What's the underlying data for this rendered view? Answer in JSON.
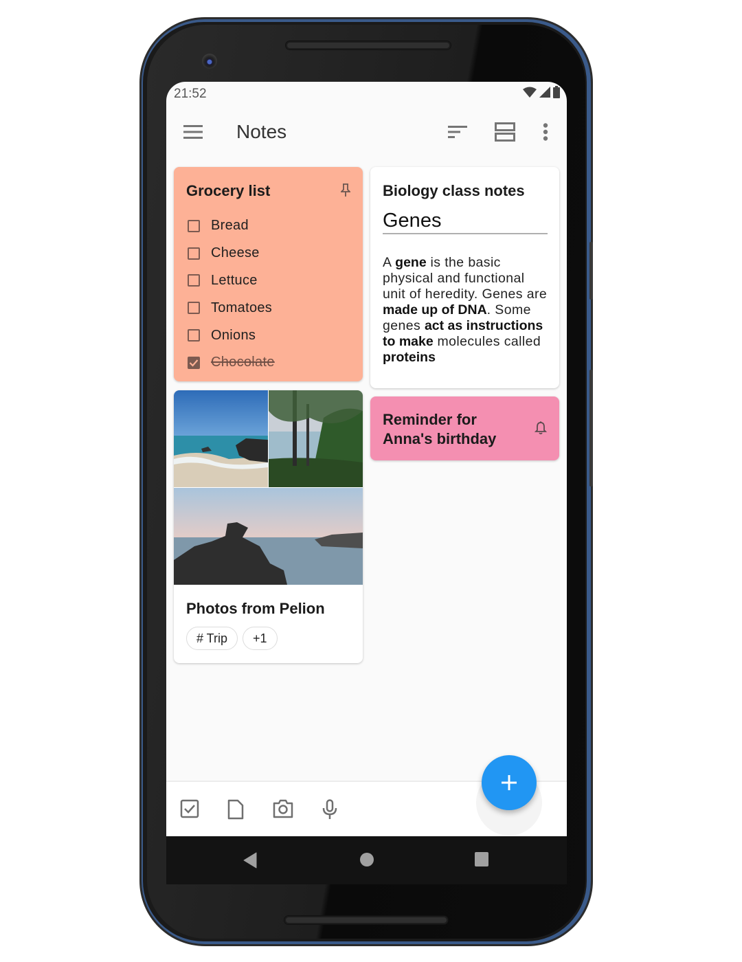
{
  "status_bar": {
    "time": "21:52",
    "icons": [
      "wifi-icon",
      "cellular-icon",
      "battery-icon"
    ]
  },
  "appbar": {
    "title": "Notes",
    "menu_icon": "menu-icon",
    "actions": [
      "sort-icon",
      "view-toggle-icon",
      "more-vert-icon"
    ]
  },
  "notes": {
    "grocery": {
      "title": "Grocery list",
      "pinned": true,
      "background": "#fdb196",
      "items": [
        {
          "label": "Bread",
          "checked": false
        },
        {
          "label": "Cheese",
          "checked": false
        },
        {
          "label": "Lettuce",
          "checked": false
        },
        {
          "label": "Tomatoes",
          "checked": false
        },
        {
          "label": "Onions",
          "checked": false
        },
        {
          "label": "Chocolate",
          "checked": true
        }
      ]
    },
    "biology": {
      "title": "Biology class notes",
      "heading": "Genes",
      "body": [
        {
          "text": "A ",
          "bold": false
        },
        {
          "text": "gene",
          "bold": true
        },
        {
          "text": " is the basic physical and functional unit of heredity. Genes are ",
          "bold": false
        },
        {
          "text": "made up of DNA",
          "bold": true
        },
        {
          "text": ". Some genes ",
          "bold": false
        },
        {
          "text": "act as instructions to make",
          "bold": true
        },
        {
          "text": " molecules called ",
          "bold": false
        },
        {
          "text": "proteins",
          "bold": true
        }
      ]
    },
    "reminder": {
      "title": "Reminder for Anna's birthday",
      "background": "#f48fb1",
      "icon": "bell-icon"
    },
    "photos": {
      "title": "Photos from Pelion",
      "images": [
        "beach-photo",
        "forest-coast-photo",
        "rocky-sea-photo"
      ],
      "chips": [
        "# Trip",
        "+1"
      ]
    }
  },
  "bottom_bar": {
    "actions": [
      "new-checklist-icon",
      "new-text-note-icon",
      "new-photo-note-icon",
      "new-audio-note-icon"
    ],
    "fab_label": "+",
    "fab_color": "#2196f3"
  },
  "system_nav": [
    "back-button",
    "home-button",
    "recents-button"
  ]
}
